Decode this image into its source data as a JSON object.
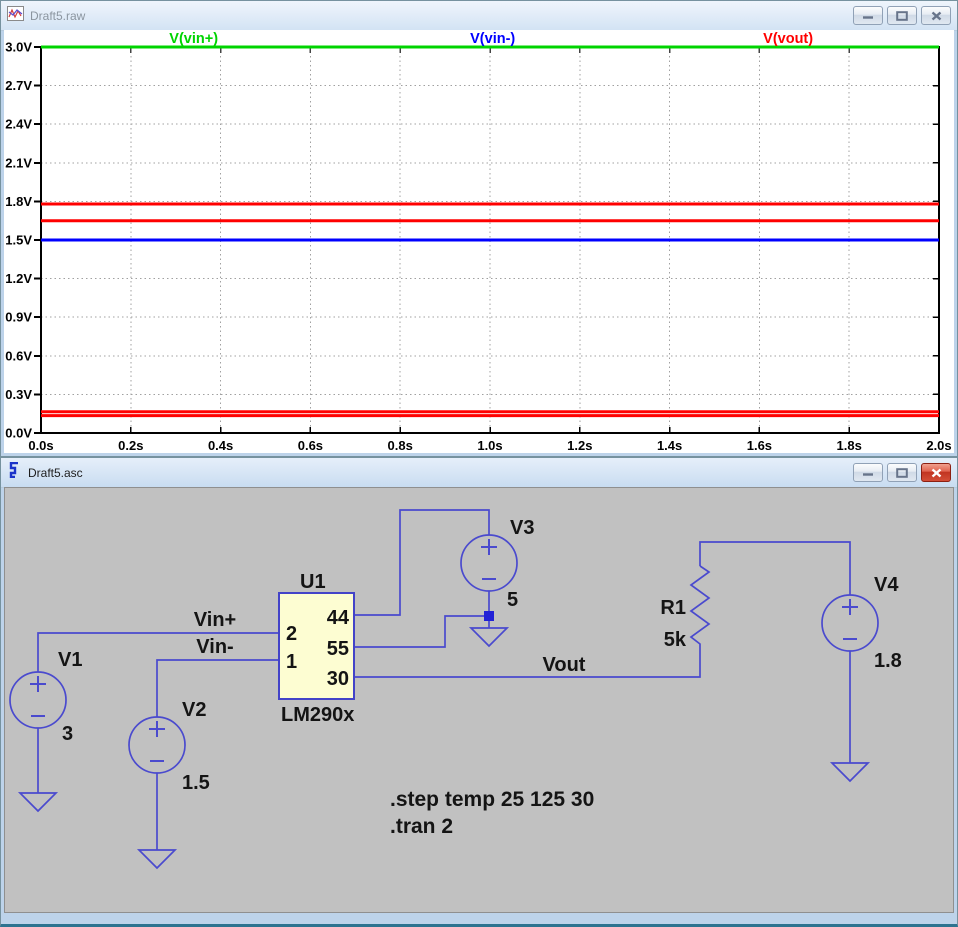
{
  "plot_window": {
    "title": "Draft5.raw",
    "icon": "waveform-icon",
    "buttons": [
      "minimize",
      "maximize",
      "close"
    ]
  },
  "schematic_window": {
    "title": "Draft5.asc",
    "icon": "ltspice-icon",
    "buttons": [
      "minimize",
      "maximize",
      "close"
    ]
  },
  "chart_data": {
    "type": "line",
    "title": "",
    "grid": true,
    "legend_position": "top",
    "x": {
      "unit": "s",
      "min": 0,
      "max": 2,
      "ticks": [
        {
          "v": 0.0,
          "label": "0.0s"
        },
        {
          "v": 0.2,
          "label": "0.2s"
        },
        {
          "v": 0.4,
          "label": "0.4s"
        },
        {
          "v": 0.6,
          "label": "0.6s"
        },
        {
          "v": 0.8,
          "label": "0.8s"
        },
        {
          "v": 1.0,
          "label": "1.0s"
        },
        {
          "v": 1.2,
          "label": "1.2s"
        },
        {
          "v": 1.4,
          "label": "1.4s"
        },
        {
          "v": 1.6,
          "label": "1.6s"
        },
        {
          "v": 1.8,
          "label": "1.8s"
        },
        {
          "v": 2.0,
          "label": "2.0s"
        }
      ]
    },
    "y": {
      "unit": "V",
      "min": 0,
      "max": 3,
      "ticks": [
        {
          "v": 0.0,
          "label": "0.0V"
        },
        {
          "v": 0.3,
          "label": "0.3V"
        },
        {
          "v": 0.6,
          "label": "0.6V"
        },
        {
          "v": 0.9,
          "label": "0.9V"
        },
        {
          "v": 1.2,
          "label": "1.2V"
        },
        {
          "v": 1.5,
          "label": "1.5V"
        },
        {
          "v": 1.8,
          "label": "1.8V"
        },
        {
          "v": 2.1,
          "label": "2.1V"
        },
        {
          "v": 2.4,
          "label": "2.4V"
        },
        {
          "v": 2.7,
          "label": "2.7V"
        },
        {
          "v": 3.0,
          "label": "3.0V"
        }
      ]
    },
    "series": [
      {
        "name": "V(vin+)",
        "color": "#00d400",
        "shape": "constant",
        "values": [
          3.0
        ]
      },
      {
        "name": "V(vin-)",
        "color": "#0000ff",
        "shape": "constant",
        "values": [
          1.5
        ]
      },
      {
        "name": "V(vout)",
        "color": "#ff0000",
        "shape": "constant",
        "values": [
          1.78,
          1.65,
          0.165,
          0.135
        ]
      }
    ]
  },
  "schematic": {
    "components": {
      "v1": {
        "name": "V1",
        "value": "3"
      },
      "v2": {
        "name": "V2",
        "value": "1.5"
      },
      "v3": {
        "name": "V3",
        "value": "5"
      },
      "v4": {
        "name": "V4",
        "value": "1.8"
      },
      "r1": {
        "name": "R1",
        "value": "5k"
      },
      "u1": {
        "name": "U1",
        "part": "LM290x",
        "left_pins": [
          "2",
          "1"
        ],
        "right_pins": [
          "44",
          "55",
          "30"
        ]
      }
    },
    "net_labels": {
      "vinp": "Vin+",
      "vinn": "Vin-",
      "vout": "Vout"
    },
    "directives": [
      ".step temp 25 125 30",
      ".tran 2"
    ]
  },
  "colors": {
    "schematic_bg": "#c1c1c1",
    "wire": "#4a4ace",
    "component_fill": "#fdfdd2",
    "junction_node": "#2121d6",
    "grid": "#a0a0a0",
    "active_close": "#c03320"
  }
}
